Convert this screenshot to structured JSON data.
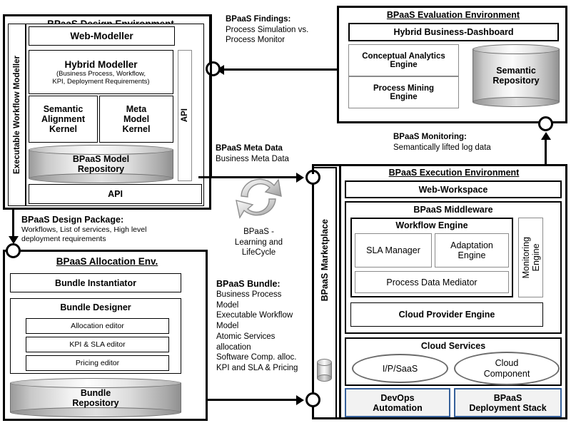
{
  "design_env": {
    "title": "BPaaS Design Environment",
    "side_label": "Executable Workflow Modeller",
    "web_modeller": "Web-Modeller",
    "hybrid_modeller": {
      "title": "Hybrid Modeller",
      "subtitle_line1": "(Business Process,  Workflow,",
      "subtitle_line2": "KPI, Deployment Requirements)"
    },
    "semantic_alignment_kernel": "Semantic\nAlignment\nKernel",
    "meta_model_kernel": "Meta\nModel\nKernel",
    "api_side": "API",
    "repository": "BPaaS Model\nRepository",
    "api_bottom": "API"
  },
  "eval_env": {
    "title": "BPaaS Evaluation Environment",
    "dashboard": "Hybrid Business-Dashboard",
    "conceptual_analytics": "Conceptual Analytics\nEngine",
    "process_mining": "Process Mining\nEngine",
    "semantic_repository": "Semantic\nRepository"
  },
  "exec_env": {
    "title": "BPaaS Execution Environment",
    "web_workspace": "Web-Workspace",
    "middleware": "BPaaS Middleware",
    "workflow_engine": "Workflow Engine",
    "sla_manager": "SLA Manager",
    "adaptation_engine": "Adaptation\nEngine",
    "process_data_mediator": "Process Data Mediator",
    "monitoring_engine": "Monitoring\nEngine",
    "cloud_provider_engine": "Cloud Provider Engine",
    "cloud_services": "Cloud Services",
    "ipsaas": "I/P/SaaS",
    "cloud_component": "Cloud\nComponent",
    "devops": "DevOps\nAutomation",
    "deployment_stack": "BPaaS\nDeployment Stack"
  },
  "marketplace": {
    "label": "BPaaS Marketplace"
  },
  "alloc_env": {
    "title": "BPaaS Allocation Env.",
    "bundle_instantiator": "Bundle Instantiator",
    "bundle_designer": "Bundle Designer",
    "allocation_editor": "Allocation editor",
    "kpi_sla_editor": "KPI & SLA editor",
    "pricing_editor": "Pricing editor",
    "bundle_repository": "Bundle\nRepository"
  },
  "annotations": {
    "findings": {
      "heading": "BPaaS Findings:",
      "line1": "Process Simulation vs.",
      "line2": "Process Monitor"
    },
    "meta_data": {
      "heading": "BPaaS Meta Data",
      "line1": "Business Meta Data"
    },
    "monitoring": {
      "heading": "BPaaS Monitoring:",
      "line1": "Semantically lifted log data"
    },
    "design_package": {
      "heading": "BPaaS Design Package:",
      "line1": "Workflows, List of services, High level",
      "line2": "deployment requirements"
    },
    "learning_cycle": {
      "line1": "BPaaS -",
      "line2": "Learning and",
      "line3": "LifeCycle"
    },
    "bundle": {
      "heading": "BPaaS Bundle:",
      "items": [
        "Business Process",
        "Model",
        "Executable Workflow",
        "Model",
        "Atomic Services",
        "allocation",
        "Software Comp. alloc.",
        "KPI and SLA & Pricing"
      ]
    }
  },
  "colors": {
    "line": "#000000",
    "blue_accent": "#36609a",
    "blue_fill": "#f2f2f2",
    "gray_border": "#7f7f7f"
  }
}
